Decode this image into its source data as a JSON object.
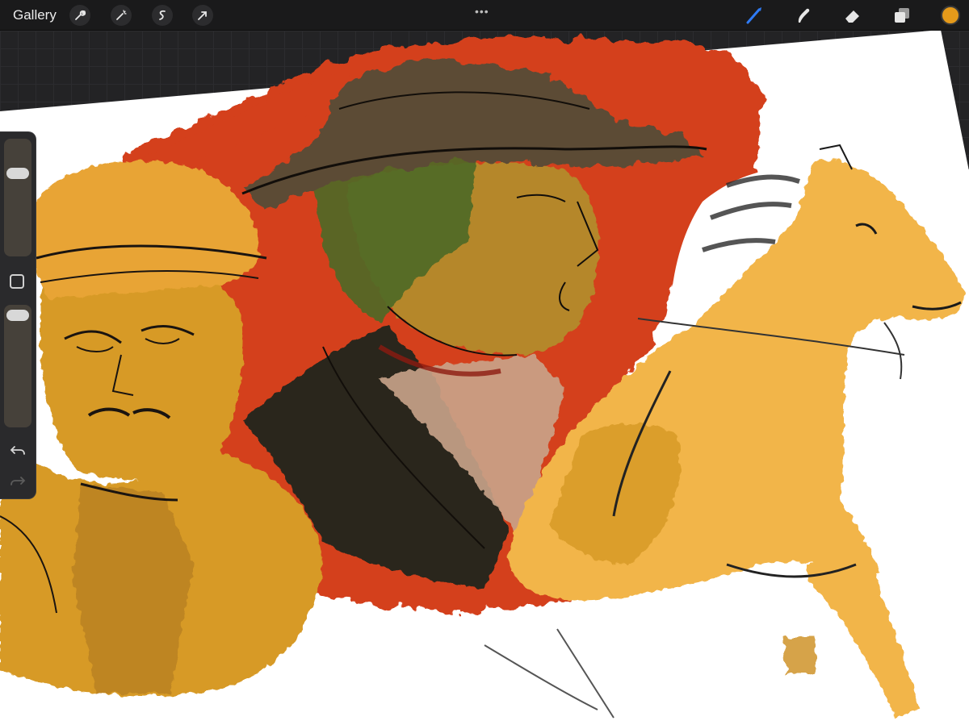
{
  "topbar": {
    "gallery_label": "Gallery",
    "more_indicator": "•••",
    "left_tools": [
      "wrench-icon",
      "magic-wand-icon",
      "selection-icon",
      "transform-arrow-icon"
    ],
    "right_tools": [
      "brush-icon",
      "smudge-icon",
      "eraser-icon",
      "layers-icon"
    ],
    "active_tool": "brush-icon",
    "active_tool_color": "#2f7bf5",
    "current_color": "#e59a1a"
  },
  "sidebar": {
    "brush_size_level": 0.82,
    "opacity_level": 0.94,
    "controls": [
      "brush-size-slider",
      "modify-button",
      "opacity-slider",
      "undo-icon",
      "redo-icon"
    ]
  },
  "canvas": {
    "artwork": "sketch-of-western-figures-and-horse",
    "palette": {
      "background_splash": "#d4401e",
      "ochre": "#d79a28",
      "horse": "#f2b549",
      "dark_coat": "#2a261c",
      "hat": "#5b4b36",
      "green": "#4e6b27",
      "paper": "#ffffff"
    }
  }
}
